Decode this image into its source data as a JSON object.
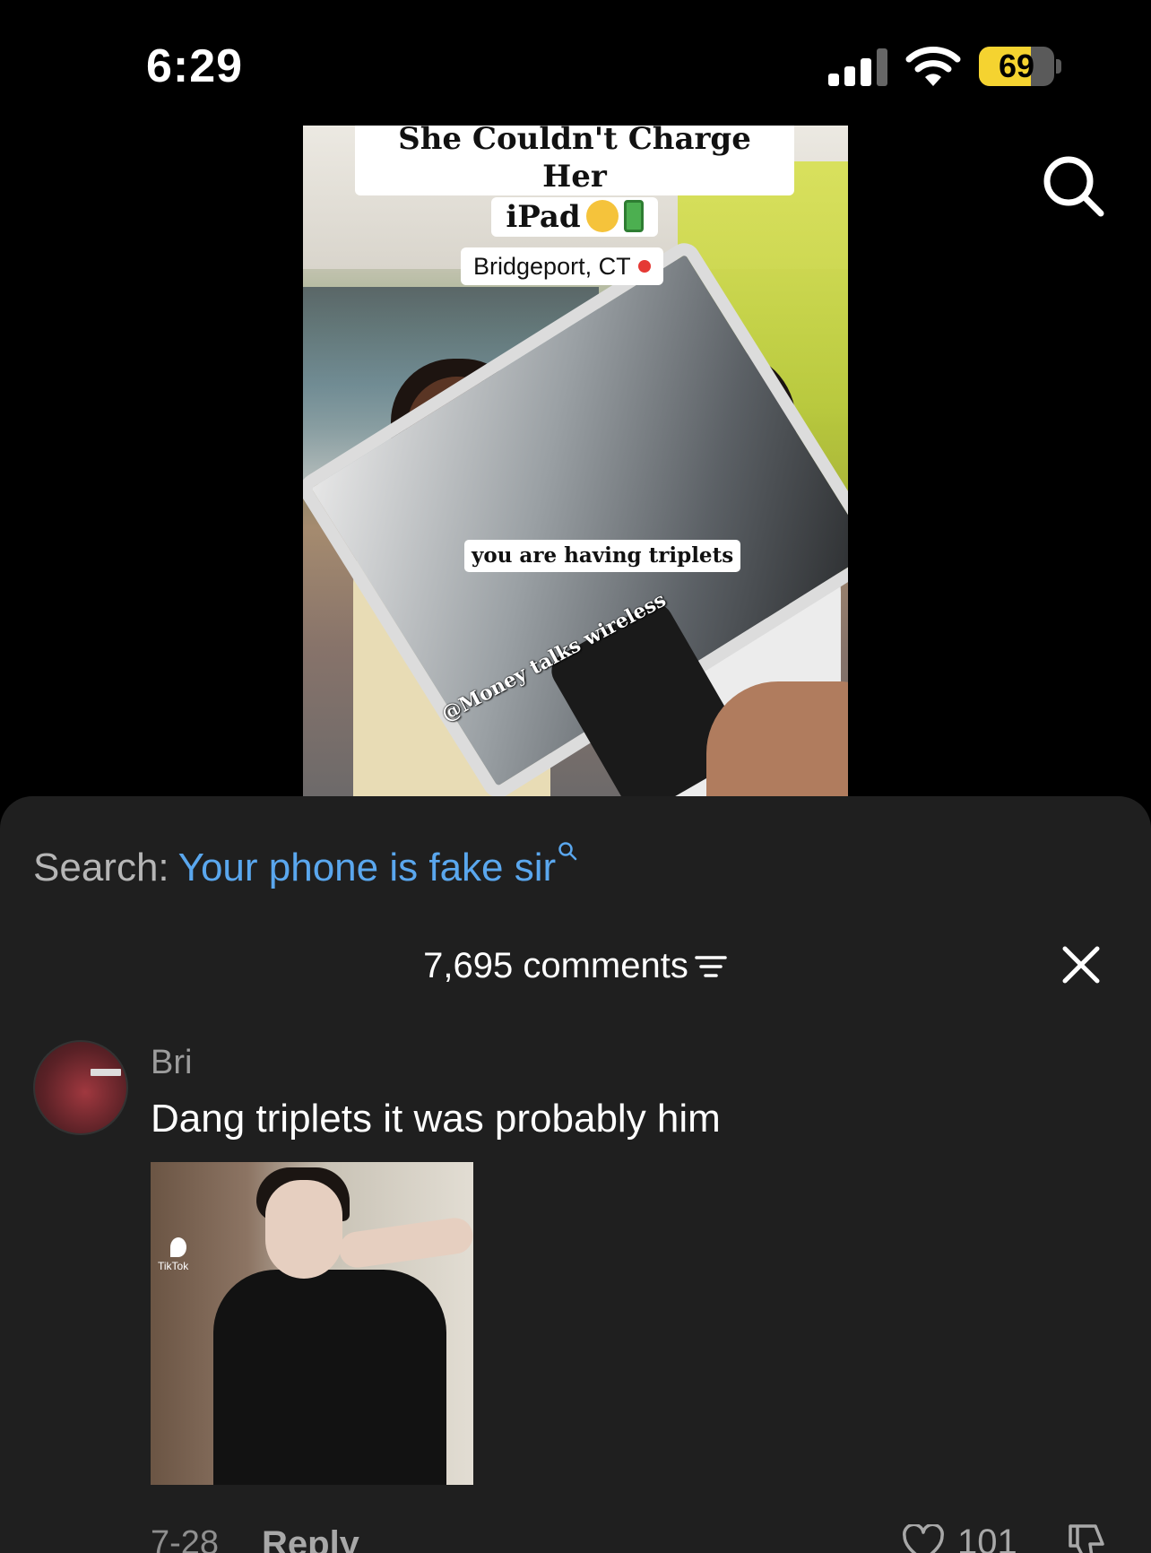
{
  "status_bar": {
    "time": "6:29",
    "battery_percent": "69",
    "battery_level": 0.69,
    "signal_icon": "signal-bars-icon",
    "wifi_icon": "wifi-icon"
  },
  "top_bar": {
    "search_icon": "search-icon"
  },
  "video": {
    "title_line1": "She Couldn't Charge Her",
    "title_line2": "iPad",
    "location": "Bridgeport, CT",
    "caption": "you are having triplets",
    "watermark": "@Money talks wireless"
  },
  "comments_sheet": {
    "search_label": "Search:",
    "search_query": "Your phone is fake sir",
    "comment_count": "7,695 comments",
    "close_icon": "close-icon",
    "filter_icon": "filter-icon"
  },
  "comment": {
    "author": "Bri",
    "text": "Dang triplets it was probably him",
    "image_logo_text": "TikTok",
    "date": "7-28",
    "reply_label": "Reply",
    "like_count": "101"
  },
  "colors": {
    "sheet_bg": "#1f1f1f",
    "link_blue": "#5aa7ee",
    "battery_yellow": "#f5d330"
  }
}
